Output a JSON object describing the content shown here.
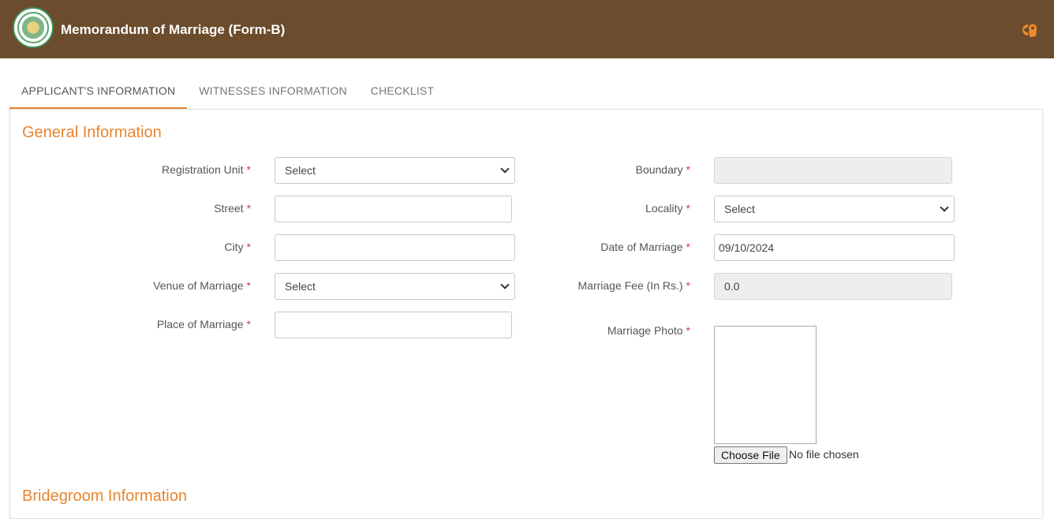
{
  "header": {
    "title": "Memorandum of Marriage (Form-B)",
    "emblem_icon": "state-emblem-icon",
    "brand_icon": "e-governance-logo-icon",
    "bg_color": "#6b4c2c"
  },
  "tabs": [
    {
      "label": "APPLICANT'S INFORMATION",
      "active": true
    },
    {
      "label": "WITNESSES INFORMATION",
      "active": false
    },
    {
      "label": "CHECKLIST",
      "active": false
    }
  ],
  "accent_color": "#e8852f",
  "general": {
    "title": "General Information",
    "registration_unit": {
      "label": "Registration Unit",
      "value": "Select"
    },
    "street": {
      "label": "Street",
      "value": ""
    },
    "city": {
      "label": "City",
      "value": ""
    },
    "venue": {
      "label": "Venue of Marriage",
      "value": "Select"
    },
    "place": {
      "label": "Place of Marriage",
      "value": ""
    },
    "boundary": {
      "label": "Boundary",
      "value": ""
    },
    "locality": {
      "label": "Locality",
      "value": "Select"
    },
    "date": {
      "label": "Date of Marriage",
      "value": "09/10/2024"
    },
    "fee": {
      "label": "Marriage Fee (In Rs.)",
      "value": "0.0"
    },
    "photo": {
      "label": "Marriage Photo",
      "button": "Choose File",
      "status": "No file chosen"
    },
    "required_mark": "*"
  },
  "bridegroom": {
    "title": "Bridegroom Information"
  }
}
